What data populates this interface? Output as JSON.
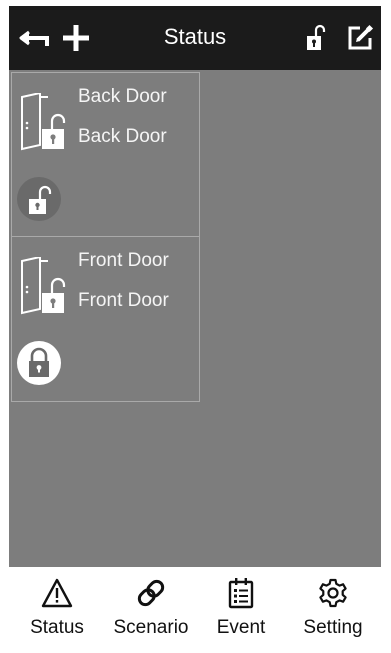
{
  "header": {
    "title": "Status"
  },
  "locks": [
    {
      "name": "Back Door",
      "subname": "Back Door",
      "state": "unlocked"
    },
    {
      "name": "Front Door",
      "subname": "Front Door",
      "state": "locked"
    }
  ],
  "tabs": [
    {
      "label": "Status",
      "icon": "warning-icon"
    },
    {
      "label": "Scenario",
      "icon": "link-icon"
    },
    {
      "label": "Event",
      "icon": "calendar-list-icon"
    },
    {
      "label": "Setting",
      "icon": "gear-icon"
    }
  ],
  "colors": {
    "header_bg": "#1b1b1b",
    "content_bg": "#7d7d7d",
    "tabbar_bg": "#ffffff"
  }
}
